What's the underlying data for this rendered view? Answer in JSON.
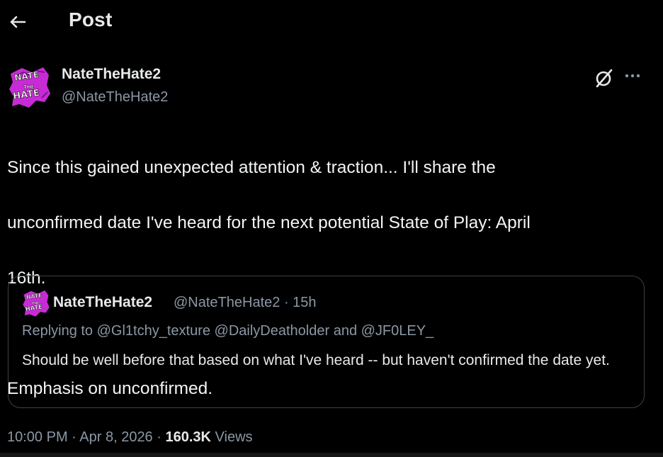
{
  "header": {
    "title": "Post",
    "back_icon": "arrow-left-icon"
  },
  "author": {
    "display_name": "NateTheHate2",
    "handle": "@NateTheHate2",
    "avatar_text_top": "NATE",
    "avatar_text_mid": "THE",
    "avatar_text_bottom": "HATE",
    "avatar_color": "#c72bd6"
  },
  "actions": {
    "grok_icon": "grok-icon",
    "more_icon": "more-dots-icon"
  },
  "post": {
    "line1": "Since this gained unexpected attention & traction... I'll share the",
    "line2": "unconfirmed date I've heard for the next potential State of Play: April",
    "line3": "16th.",
    "line4": "Emphasis on unconfirmed."
  },
  "quote": {
    "display_name": "NateTheHate2",
    "handle_time": "@NateTheHate2 · 15h",
    "replying_to": "Replying to @Gl1tchy_texture @DailyDeatholder and @JF0LEY_",
    "text": "Should be well before that based on what I've heard -- but haven't confirmed the date yet."
  },
  "meta": {
    "time_date": "10:00 PM · Apr 8, 2026 · ",
    "views_count": "160.3K",
    "views_label": " Views"
  },
  "colors": {
    "background": "#000000",
    "primary_text": "#e7e9ea",
    "secondary_text": "#8b98a5",
    "border": "#3c4146"
  }
}
